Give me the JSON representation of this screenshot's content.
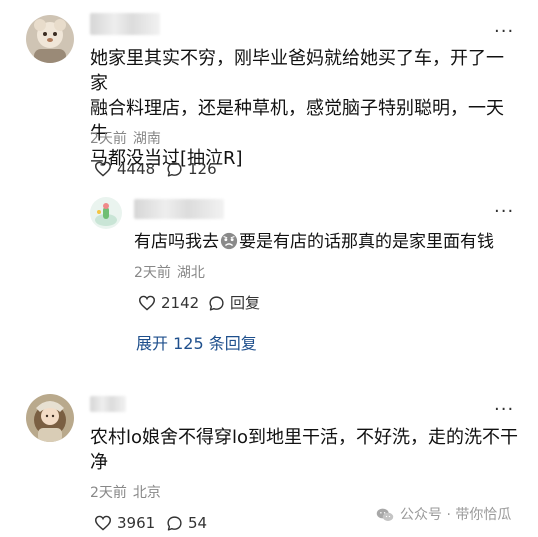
{
  "comments": [
    {
      "username": "",
      "content_lines": [
        "她家里其实不穷，刚毕业爸妈就给她买了车，开了一家",
        "融合料理店，还是种草机，感觉脑子特别聪明，一天牛",
        "马都没当过[抽泣R]"
      ],
      "time": "2天前",
      "location": "湖南",
      "likes": "4448",
      "replies": "126",
      "more_icon": "more-dots-icon"
    },
    {
      "username": "",
      "content_before_emoji": "有店吗我去",
      "content_after_emoji": "要是有店的话那真的是家里面有钱",
      "time": "2天前",
      "location": "湖北",
      "likes": "2142",
      "reply_label": "回复",
      "more_icon": "more-dots-icon"
    },
    {
      "username": "",
      "content_lines": [
        "农村lo娘舍不得穿lo到地里干活，不好洗，走的洗不干",
        "净"
      ],
      "time": "2天前",
      "location": "北京",
      "likes": "3961",
      "replies": "54",
      "more_icon": "more-dots-icon"
    }
  ],
  "expand_label": "展开 125 条回复",
  "watermark": "公众号 · 带你恰瓜"
}
